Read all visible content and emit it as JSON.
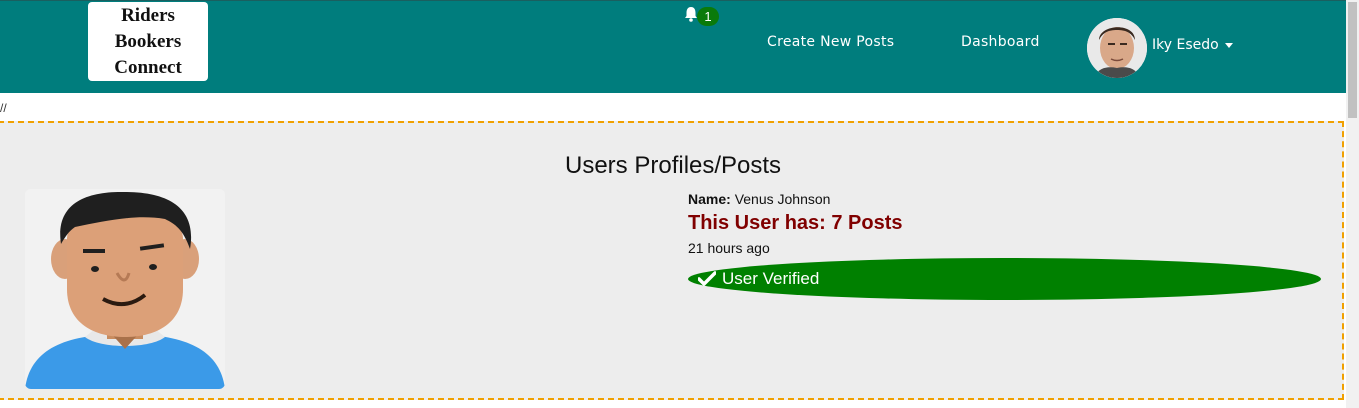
{
  "brand": {
    "line1": "Riders Bookers",
    "line2": "Connect"
  },
  "notifications": {
    "count": "1",
    "icon": "bell-icon"
  },
  "nav": {
    "create_post": "Create New Posts",
    "dashboard": "Dashboard"
  },
  "user": {
    "name": "Iky Esedo"
  },
  "breadcrumb": {
    "text": "//"
  },
  "profile": {
    "title": "Users Profiles/Posts",
    "name_label": "Name:",
    "name_value": "Venus Johnson",
    "posts_text": "This User has: 7 Posts",
    "time_ago": "21 hours ago",
    "verified_text": "User Verified"
  },
  "colors": {
    "navbar": "#007d7d",
    "verified": "#008000",
    "posts_text": "#800000",
    "dashed_border": "#f0a000"
  }
}
